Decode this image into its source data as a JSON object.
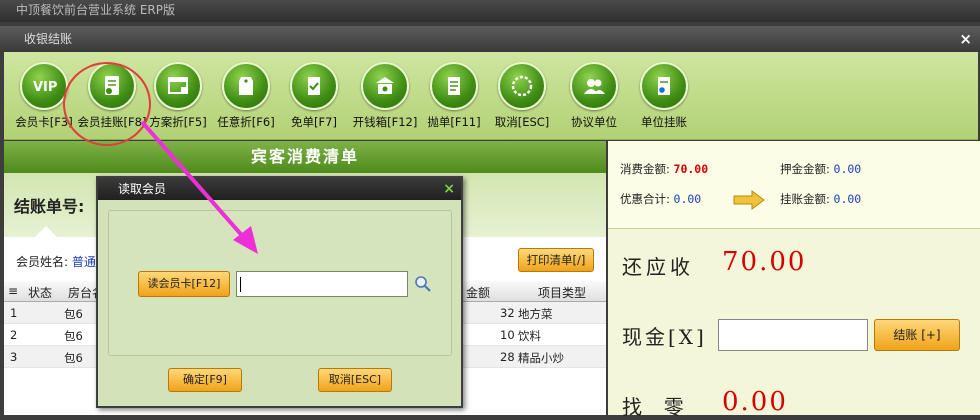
{
  "app": {
    "title": "中顶餐饮前台营业系统 ERP版"
  },
  "window": {
    "title": "收银结账",
    "close": "×"
  },
  "toolbar": [
    {
      "label": "会员卡[F3]",
      "icon": "vip-icon"
    },
    {
      "label": "会员挂账[F8]",
      "icon": "vip-document-icon"
    },
    {
      "label": "方案折[F5]",
      "icon": "window-icon"
    },
    {
      "label": "任意折[F6]",
      "icon": "tag-icon"
    },
    {
      "label": "免单[F7]",
      "icon": "checklist-icon"
    },
    {
      "label": "开钱箱[F12]",
      "icon": "cash-drawer-icon"
    },
    {
      "label": "抛单[F11]",
      "icon": "document-icon"
    },
    {
      "label": "取消[ESC]",
      "icon": "cancel-ring-icon"
    },
    {
      "label": "协议单位",
      "icon": "users-icon"
    },
    {
      "label": "单位挂账",
      "icon": "unit-document-icon"
    }
  ],
  "bill": {
    "title": "宾客消费清单",
    "number_label": "结账单号:",
    "member_label": "会员姓名:",
    "member_value": "普通",
    "print_button": "打印清单[/]",
    "columns": [
      "状态",
      "房台名",
      "金额",
      "项目类型"
    ],
    "rows": [
      {
        "idx": "1",
        "room": "包6",
        "amount": "32",
        "type": "地方菜"
      },
      {
        "idx": "2",
        "room": "包6",
        "amount": "10",
        "type": "饮料"
      },
      {
        "idx": "3",
        "room": "包6",
        "amount": "28",
        "type": "精品小炒"
      }
    ]
  },
  "summary": {
    "consume_label": "消费金额:",
    "consume_value": "70.00",
    "deposit_label": "押金金额:",
    "deposit_value": "0.00",
    "discount_label": "优惠合计:",
    "discount_value": "0.00",
    "credit_label": "挂账金额:",
    "credit_value": "0.00"
  },
  "payment": {
    "due_label": "还应收",
    "due_value": "70.00",
    "cash_label": "现金[X]",
    "cash_value": "",
    "settle_button": "结账 [+]",
    "change_label": "找  零",
    "change_value": "0.00"
  },
  "dialog": {
    "title": "读取会员",
    "close": "×",
    "read_button": "读会员卡[F12]",
    "card_value": "",
    "ok_button": "确定[F9]",
    "cancel_button": "取消[ESC]"
  },
  "colors": {
    "accent_green": "#4e8a1c",
    "button_orange": "#f0a319",
    "due_red": "#d60000",
    "annotation_pink": "#ee2fd8",
    "annotation_red": "#e23c3c"
  }
}
